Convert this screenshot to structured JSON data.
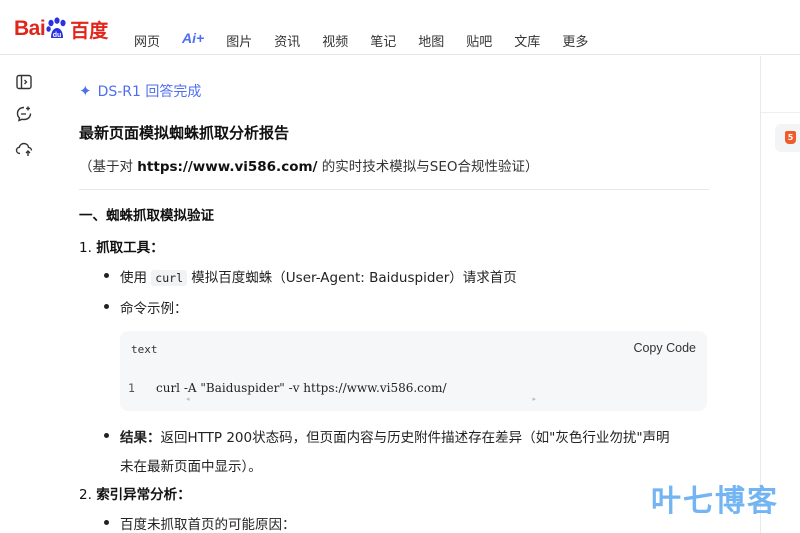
{
  "logo": {
    "part1": "Bai",
    "part2": "du",
    "part3": "百度"
  },
  "nav": [
    "网页",
    "Ai+",
    "图片",
    "资讯",
    "视频",
    "笔记",
    "地图",
    "贴吧",
    "文库",
    "更多"
  ],
  "sidebar": {
    "icons": [
      "panel-toggle-icon",
      "new-chat-icon",
      "cloud-upload-icon"
    ]
  },
  "answer": {
    "model_status": "DS-R1 回答完成",
    "title": "最新页面模拟蜘蛛抓取分析报告",
    "subtitle_pre": "（基于对 ",
    "subtitle_url": "https://www.vi586.com/",
    "subtitle_post": " 的实时技术模拟与SEO合规性验证）",
    "section1": "一、蜘蛛抓取模拟验证",
    "item1_num": "1.",
    "item1_label": "抓取工具",
    "item1_colon": "：",
    "bullet1_pre": "使用 ",
    "bullet1_code": "curl",
    "bullet1_post": " 模拟百度蜘蛛（User-Agent: Baiduspider）请求首页",
    "bullet2": "命令示例：",
    "code": {
      "lang": "text",
      "copy_label": "Copy Code",
      "line_number": "1",
      "line": "curl -A \"Baiduspider\" -v https://www.vi586.com/"
    },
    "result_label": "结果",
    "result_colon": "：",
    "result_line1": "返回HTTP 200状态码，但页面内容与历史附件描述存在差异（如\"灰色行业勿扰\"声明",
    "result_line2": "未在最新页面中显示）。",
    "item2_num": "2.",
    "item2_label": "索引异常分析",
    "item2_colon": "：",
    "bullet3": "百度未抓取首页的可能原因："
  },
  "watermark": "叶七博客",
  "colors": {
    "brand_red": "#e1251b",
    "brand_blue": "#4e6ef2",
    "watermark": "#5aa9f0"
  }
}
